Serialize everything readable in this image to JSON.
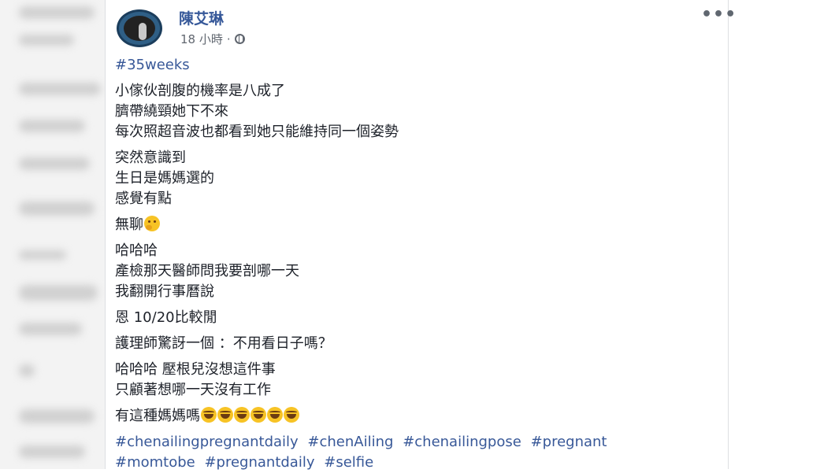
{
  "post": {
    "author": "陳艾琳",
    "time": "18 小時",
    "separator": "·",
    "privacy_icon": "globe-icon",
    "more_icon": "more-options-icon",
    "more_glyph": "•••",
    "hashtag_top": "#35weeks",
    "paragraphs": [
      [
        "小傢伙剖腹的機率是八成了",
        "臍帶繞頸她下不來",
        "每次照超音波也都看到她只能維持同一個姿勢"
      ],
      [
        "突然意識到",
        "生日是媽媽選的",
        "感覺有點"
      ],
      [
        "無聊"
      ],
      [
        "哈哈哈",
        "產檢那天醫師問我要剖哪一天",
        "我翻開行事曆說"
      ],
      [
        "恩 10/20比較閒"
      ],
      [
        "護理師驚訝一個 ：不用看日子嗎？"
      ],
      [
        "哈哈哈 壓根兒沒想這件事",
        "只顧著想哪一天沒有工作"
      ],
      [
        "有這種媽媽嗎"
      ]
    ],
    "thinking_emoji": "thinking-face-icon",
    "laugh_emoji": "grinning-squinting-face-icon",
    "laugh_emoji_count": 6,
    "hashtags_line1": [
      "#chenailingpregnantdaily",
      "#chenAiling",
      "#chenailingpose",
      "#pregnant"
    ],
    "hashtags_line2": [
      "#momtobe",
      "#pregnantdaily",
      "#selfie"
    ]
  },
  "colors": {
    "author": "#365899",
    "hashtag": "#385898",
    "text": "#1d2129",
    "meta": "#616770",
    "emoji": "#f7c325"
  }
}
